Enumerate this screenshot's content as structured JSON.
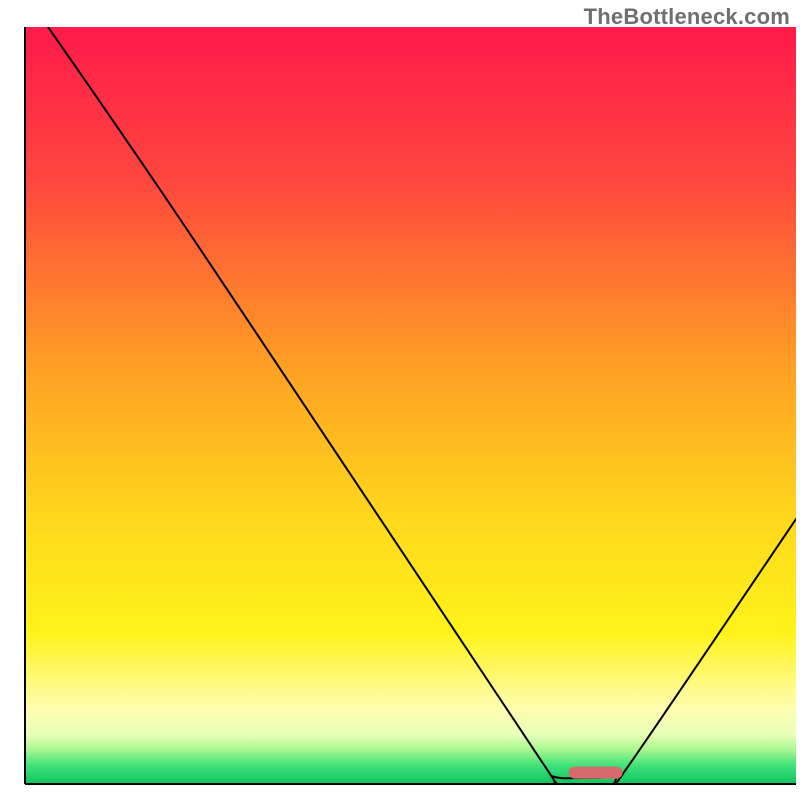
{
  "watermark": "TheBottleneck.com",
  "chart_data": {
    "type": "line",
    "title": "",
    "xlabel": "",
    "ylabel": "",
    "xlim": [
      0,
      100
    ],
    "ylim": [
      0,
      100
    ],
    "grid": false,
    "legend": false,
    "gradient_stops": [
      {
        "offset": 0.0,
        "color": "#ff1a4a"
      },
      {
        "offset": 0.2,
        "color": "#ff463e"
      },
      {
        "offset": 0.45,
        "color": "#ffa024"
      },
      {
        "offset": 0.65,
        "color": "#ffd81c"
      },
      {
        "offset": 0.8,
        "color": "#fff31a"
      },
      {
        "offset": 0.9,
        "color": "#fffdb0"
      },
      {
        "offset": 0.935,
        "color": "#e8ffb8"
      },
      {
        "offset": 0.955,
        "color": "#a8f78e"
      },
      {
        "offset": 0.975,
        "color": "#41e27a"
      },
      {
        "offset": 1.0,
        "color": "#0fc45e"
      }
    ],
    "series": [
      {
        "name": "bottleneck-curve",
        "points": [
          {
            "x": 3.0,
            "y": 100.0
          },
          {
            "x": 22.5,
            "y": 71.0
          },
          {
            "x": 67.0,
            "y": 3.0
          },
          {
            "x": 68.5,
            "y": 1.0
          },
          {
            "x": 72.5,
            "y": 0.8
          },
          {
            "x": 76.5,
            "y": 1.0
          },
          {
            "x": 78.0,
            "y": 2.0
          },
          {
            "x": 100.0,
            "y": 35.0
          }
        ],
        "stroke": "#000000",
        "stroke_width": 2
      }
    ],
    "marker": {
      "x": 74.0,
      "y": 1.5,
      "width": 7.0,
      "height": 1.6,
      "color": "#d86a6d",
      "shape": "pill"
    },
    "axes": {
      "left": {
        "x": 3.0
      },
      "bottom": {
        "y": 0.0
      },
      "stroke": "#000000",
      "stroke_width": 2
    }
  }
}
